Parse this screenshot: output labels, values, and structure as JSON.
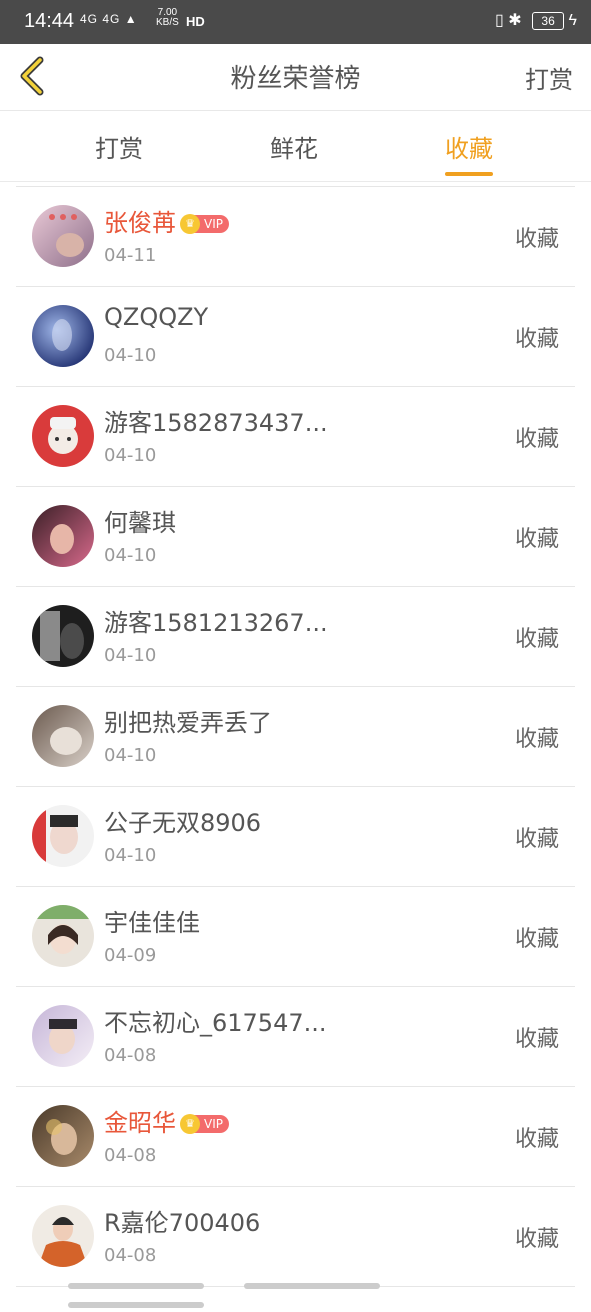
{
  "status": {
    "time": "14:44",
    "network": "4G 4G",
    "speed_top": "7.00",
    "speed_bottom": "KB/S",
    "hd": "HD",
    "battery": "36"
  },
  "header": {
    "title": "粉丝荣誉榜",
    "right_label": "打赏"
  },
  "tabs": [
    {
      "label": "打赏"
    },
    {
      "label": "鲜花"
    },
    {
      "label": "收藏"
    }
  ],
  "active_tab": "收藏",
  "vip_label": "VIP",
  "rows": [
    {
      "name": "张俊苒",
      "date": "04-11",
      "action": "收藏",
      "vip": true
    },
    {
      "name": "QZQQZY",
      "date": "04-10",
      "action": "收藏",
      "vip": false
    },
    {
      "name": "游客1582873437...",
      "date": "04-10",
      "action": "收藏",
      "vip": false
    },
    {
      "name": "何馨琪",
      "date": "04-10",
      "action": "收藏",
      "vip": false
    },
    {
      "name": "游客1581213267...",
      "date": "04-10",
      "action": "收藏",
      "vip": false
    },
    {
      "name": "别把热爱弄丢了",
      "date": "04-10",
      "action": "收藏",
      "vip": false
    },
    {
      "name": "公子无双8906",
      "date": "04-10",
      "action": "收藏",
      "vip": false
    },
    {
      "name": "宇佳佳佳",
      "date": "04-09",
      "action": "收藏",
      "vip": false
    },
    {
      "name": "不忘初心_617547...",
      "date": "04-08",
      "action": "收藏",
      "vip": false
    },
    {
      "name": "金昭华",
      "date": "04-08",
      "action": "收藏",
      "vip": true
    },
    {
      "name": "R嘉伦700406",
      "date": "04-08",
      "action": "收藏",
      "vip": false
    }
  ]
}
